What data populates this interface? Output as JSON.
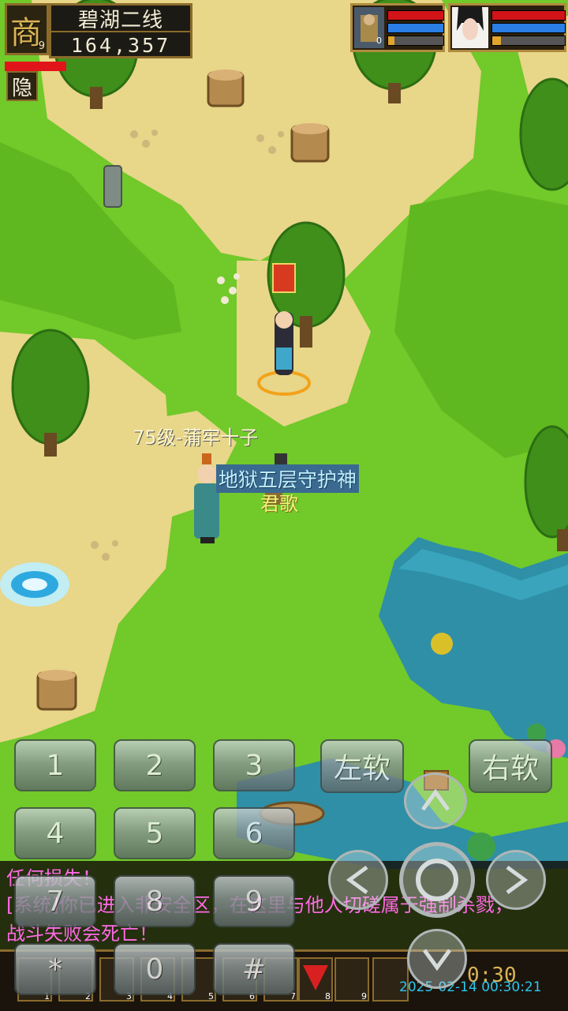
{
  "player": {
    "portrait_glyph": "商",
    "level": "9",
    "map_name": "碧湖二线",
    "money": "164,357",
    "hide_label": "隐"
  },
  "party": [
    {
      "hp": 1.0,
      "mp": 1.0,
      "xp": 0.1,
      "level": "0"
    },
    {
      "hp": 1.0,
      "mp": 1.0,
      "xp": 0.1
    }
  ],
  "map": {
    "npc_name": "75级-蒲牢十子",
    "guard_name": "地狱五层守护神",
    "guard_subtitle": "君歌"
  },
  "keypad": {
    "keys": [
      "1",
      "2",
      "3",
      "4",
      "5",
      "6",
      "7",
      "8",
      "9",
      "*",
      "0",
      "#"
    ],
    "left_soft": "左软",
    "right_soft": "右软"
  },
  "chat": {
    "lines": [
      "任何损失！",
      "[系统]你已进入非安全区，在这里与他人切磋属于强制杀戮，",
      "战斗失败会死亡！"
    ]
  },
  "skillbar": {
    "slot_numbers": [
      "1",
      "2",
      "3",
      "4",
      "5",
      "6",
      "7",
      "8",
      "9"
    ],
    "timer": "0:30",
    "timestamp": "2025-02-14 00:30:21"
  }
}
